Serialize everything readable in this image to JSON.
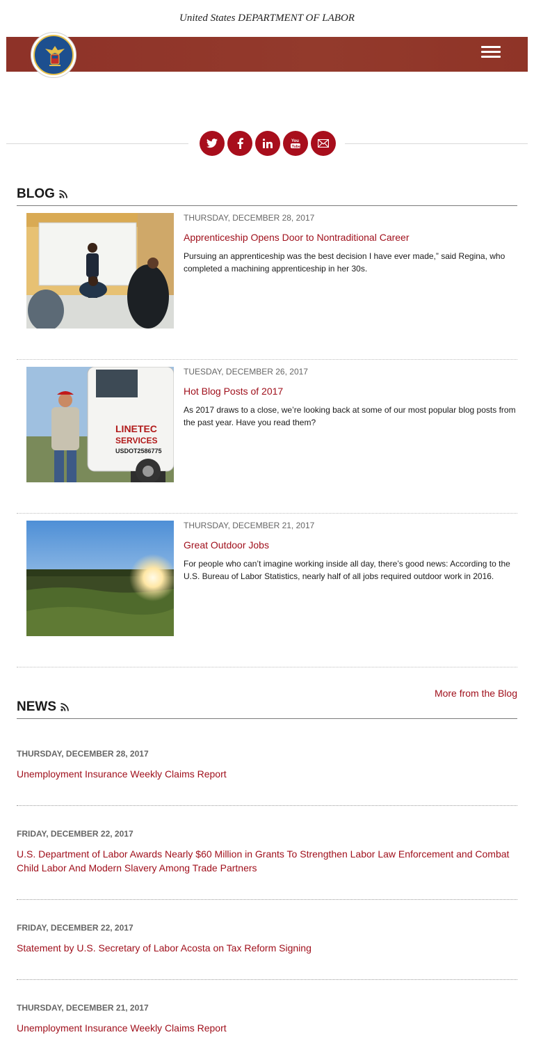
{
  "header": {
    "agency_line": "United States DEPARTMENT OF LABOR",
    "seal_icon": "dol-seal-icon",
    "menu_icon": "hamburger-menu-icon",
    "banner_color": "#8e3228"
  },
  "social": {
    "accent_color": "#a80e1c",
    "items": [
      {
        "icon": "twitter-icon",
        "glyph": "t"
      },
      {
        "icon": "facebook-icon",
        "glyph": "f"
      },
      {
        "icon": "linkedin-icon",
        "glyph": "in"
      },
      {
        "icon": "youtube-icon",
        "glyph": "▶"
      },
      {
        "icon": "email-icon",
        "glyph": "✉"
      }
    ]
  },
  "blog": {
    "heading": "BLOG",
    "rss_icon": "rss-icon",
    "more_link": "More from the Blog",
    "items": [
      {
        "date": "THURSDAY, DECEMBER 28, 2017",
        "title": "Apprenticeship Opens Door to Nontraditional Career",
        "excerpt": "Pursuing an apprenticeship was the best decision I have ever made,” said Regina, who completed a machining apprenticeship in her 30s."
      },
      {
        "date": "TUESDAY, DECEMBER 26, 2017",
        "title": "Hot Blog Posts of 2017",
        "excerpt": "As 2017 draws to a close, we’re looking back at some of our most popular blog posts from the past year. Have you read them?"
      },
      {
        "date": "THURSDAY, DECEMBER 21, 2017",
        "title": "Great Outdoor Jobs",
        "excerpt": "For people who can’t imagine working inside all day, there’s good news: According to the U.S. Bureau of Labor Statistics, nearly half of all jobs required outdoor work in 2016."
      }
    ],
    "truck_text": {
      "brand_a": "LINETEC",
      "brand_b": "SERVICES",
      "usdot": "USDOT2586775"
    }
  },
  "news": {
    "heading": "NEWS",
    "rss_icon": "rss-icon",
    "items": [
      {
        "date": "THURSDAY, DECEMBER 28, 2017",
        "title": "Unemployment Insurance Weekly Claims Report"
      },
      {
        "date": "FRIDAY, DECEMBER 22, 2017",
        "title": "U.S. Department of Labor Awards Nearly $60 Million in Grants To Strengthen Labor Law Enforcement and Combat Child Labor And Modern Slavery Among Trade Partners"
      },
      {
        "date": "FRIDAY, DECEMBER 22, 2017",
        "title": "Statement by U.S. Secretary of Labor Acosta on Tax Reform Signing"
      },
      {
        "date": "THURSDAY, DECEMBER 21, 2017",
        "title": "Unemployment Insurance Weekly Claims Report"
      }
    ]
  }
}
